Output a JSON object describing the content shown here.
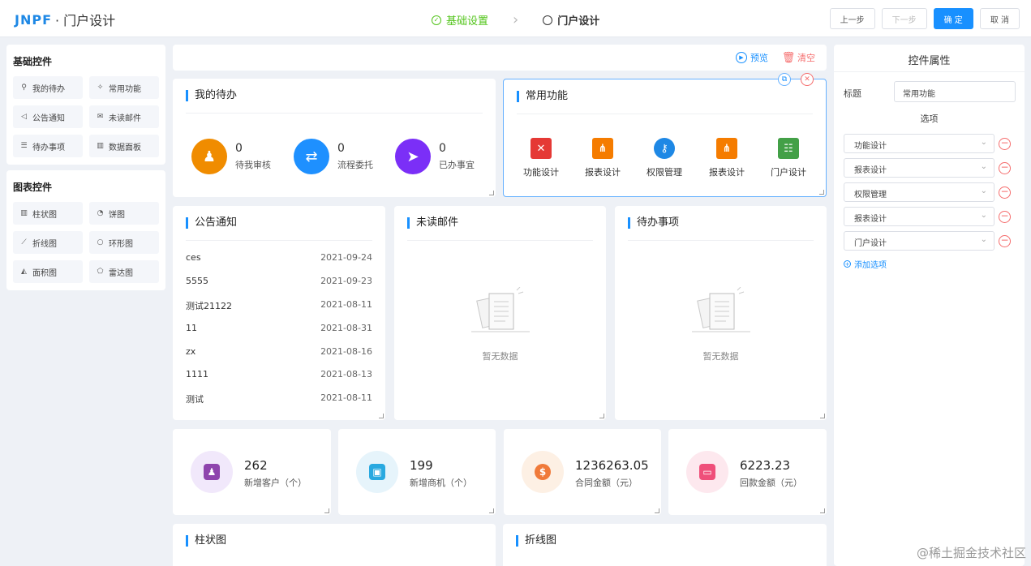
{
  "header": {
    "brand": "JNPF",
    "title": "· 门户设计",
    "steps": [
      {
        "label": "基础设置",
        "state": "done"
      },
      {
        "label": "门户设计",
        "state": "current"
      }
    ],
    "buttons": {
      "prev": "上一步",
      "next": "下一步",
      "confirm": "确 定",
      "cancel": "取 消"
    }
  },
  "left_panel": {
    "basic": {
      "title": "基础控件",
      "items": [
        {
          "label": "我的待办",
          "icon": "stamp-icon"
        },
        {
          "label": "常用功能",
          "icon": "star-icon"
        },
        {
          "label": "公告通知",
          "icon": "speaker-icon"
        },
        {
          "label": "未读邮件",
          "icon": "mail-icon"
        },
        {
          "label": "待办事项",
          "icon": "list-icon"
        },
        {
          "label": "数据面板",
          "icon": "bar-icon"
        }
      ]
    },
    "charts": {
      "title": "图表控件",
      "items": [
        {
          "label": "柱状图",
          "icon": "bar-chart-icon"
        },
        {
          "label": "饼图",
          "icon": "pie-chart-icon"
        },
        {
          "label": "折线图",
          "icon": "line-chart-icon"
        },
        {
          "label": "环形图",
          "icon": "ring-chart-icon"
        },
        {
          "label": "面积图",
          "icon": "area-chart-icon"
        },
        {
          "label": "雷达图",
          "icon": "radar-chart-icon"
        }
      ]
    }
  },
  "toolbar": {
    "preview": "预览",
    "clear": "清空"
  },
  "todo": {
    "title": "我的待办",
    "items": [
      {
        "value": "0",
        "label": "待我审核",
        "color": "#f08c00"
      },
      {
        "value": "0",
        "label": "流程委托",
        "color": "#1e90ff"
      },
      {
        "value": "0",
        "label": "已办事宜",
        "color": "#7b2ff7"
      }
    ]
  },
  "common": {
    "title": "常用功能",
    "items": [
      {
        "label": "功能设计",
        "color": "#e53935"
      },
      {
        "label": "报表设计",
        "color": "#f57c00"
      },
      {
        "label": "权限管理",
        "color": "#1e88e5"
      },
      {
        "label": "报表设计",
        "color": "#f57c00"
      },
      {
        "label": "门户设计",
        "color": "#43a047"
      }
    ]
  },
  "notice": {
    "title": "公告通知",
    "rows": [
      {
        "name": "ces",
        "date": "2021-09-24"
      },
      {
        "name": "5555",
        "date": "2021-09-23"
      },
      {
        "name": "测试21122",
        "date": "2021-08-11"
      },
      {
        "name": "11",
        "date": "2021-08-31"
      },
      {
        "name": "zx",
        "date": "2021-08-16"
      },
      {
        "name": "1111",
        "date": "2021-08-13"
      },
      {
        "name": "测试",
        "date": "2021-08-11"
      }
    ]
  },
  "mail": {
    "title": "未读邮件",
    "empty": "暂无数据"
  },
  "tasks": {
    "title": "待办事项",
    "empty": "暂无数据"
  },
  "stats": [
    {
      "value": "262",
      "label": "新增客户（个）",
      "bg": "#f1e8fb",
      "fg": "#8e44ad"
    },
    {
      "value": "199",
      "label": "新增商机（个）",
      "bg": "#e6f4fb",
      "fg": "#29a9e0"
    },
    {
      "value": "1236263.05",
      "label": "合同金额（元）",
      "bg": "#fdf0e4",
      "fg": "#f07a3a"
    },
    {
      "value": "6223.23",
      "label": "回款金额（元）",
      "bg": "#fde8ee",
      "fg": "#ef4f7a"
    }
  ],
  "bar_card": {
    "title": "柱状图"
  },
  "line_card": {
    "title": "折线图"
  },
  "props": {
    "title": "控件属性",
    "field_label": "标题",
    "field_value": "常用功能",
    "options_title": "选项",
    "options": [
      "功能设计",
      "报表设计",
      "权限管理",
      "报表设计",
      "门户设计"
    ],
    "add_label": "添加选项"
  },
  "watermark": "@稀土掘金技术社区"
}
